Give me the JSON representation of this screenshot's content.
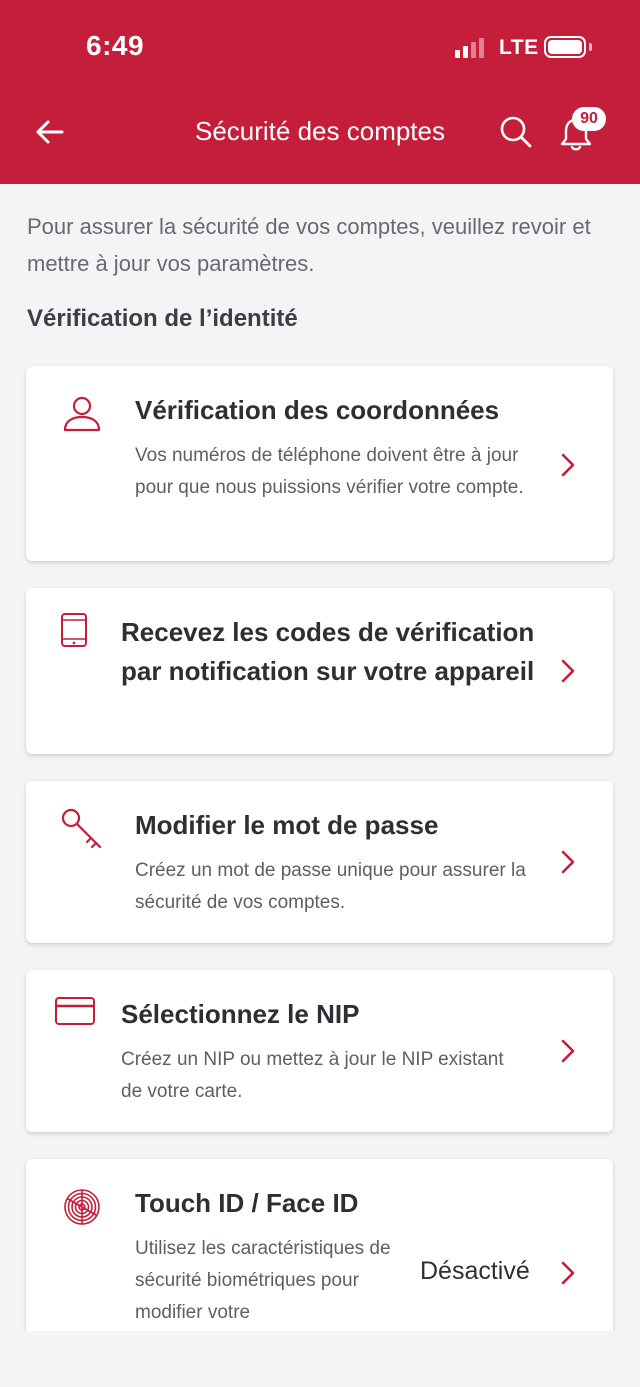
{
  "status_bar": {
    "time": "6:49",
    "network": "LTE"
  },
  "header": {
    "title": "Sécurité des comptes",
    "notification_count": "90"
  },
  "intro": "Pour assurer la sécurité de vos comptes, veuillez revoir et mettre à jour vos paramètres.",
  "section_title": "Vérification de l’identité",
  "cards": [
    {
      "title": "Vérification des coordonnées",
      "description": "Vos numéros de téléphone doivent être à jour pour que nous puissions vérifier votre compte.",
      "icon": "person-icon"
    },
    {
      "title": "Recevez les codes de vérification par notification sur votre appareil",
      "description": "",
      "icon": "tablet-icon"
    },
    {
      "title": "Modifier le mot de passe",
      "description": "Créez un mot de passe unique pour assurer la sécurité de vos comptes.",
      "icon": "key-icon"
    },
    {
      "title": "Sélectionnez le NIP",
      "description": "Créez un NIP ou mettez à jour le NIP existant de votre carte.",
      "icon": "card-icon"
    },
    {
      "title": "Touch ID / Face ID",
      "description": "Utilisez les caractéristiques de sécurité biométriques pour modifier votre",
      "status": "Désactivé",
      "icon": "fingerprint-icon"
    }
  ],
  "colors": {
    "brand": "#c41e3a",
    "background": "#f3f4f6",
    "text": "#2c2f33"
  }
}
